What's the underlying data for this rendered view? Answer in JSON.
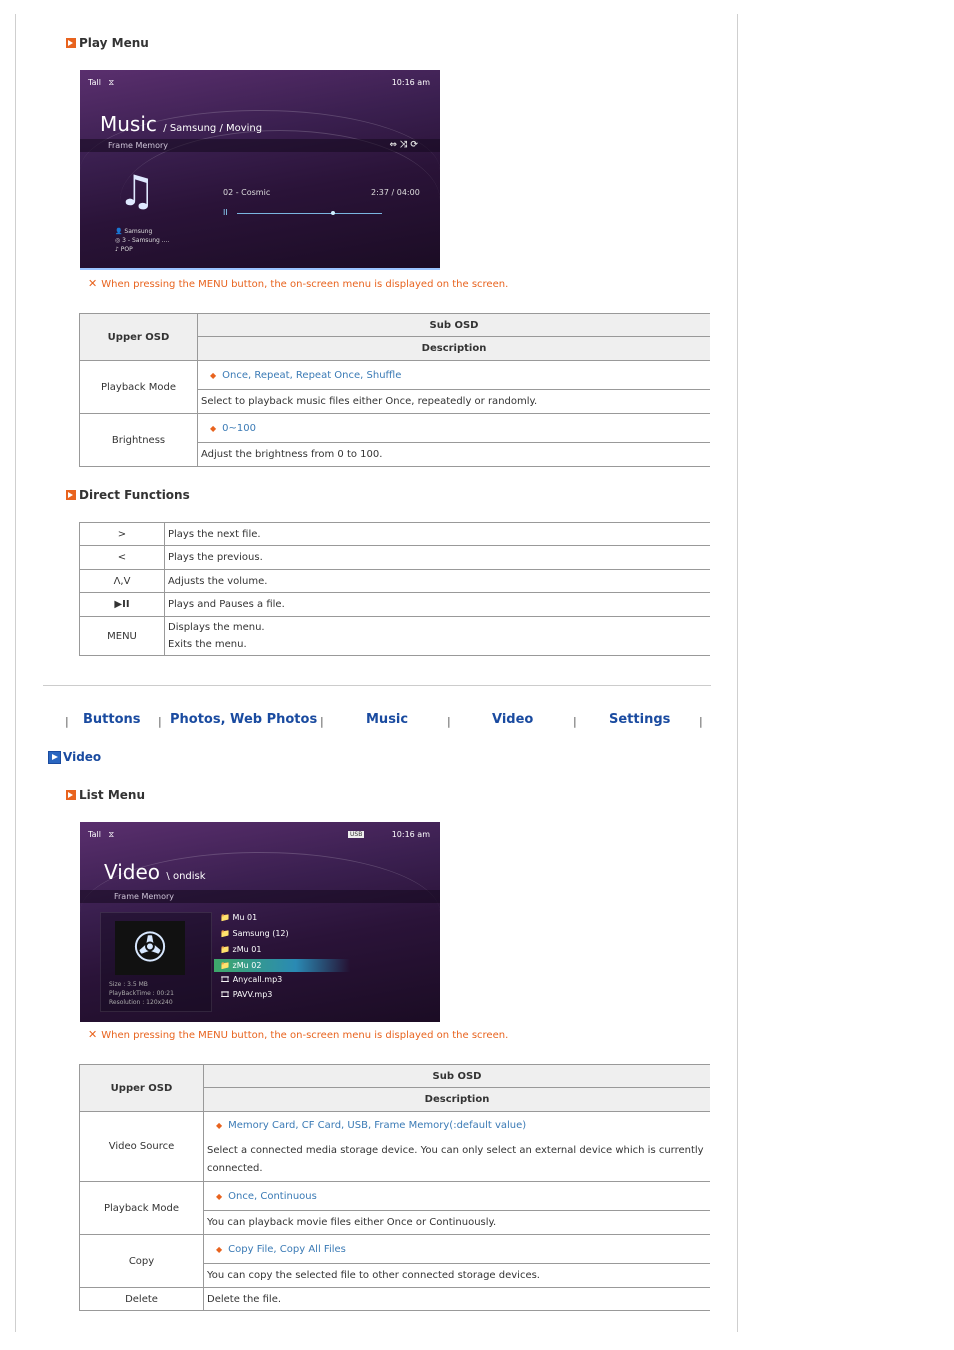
{
  "play_menu": {
    "heading": "Play Menu",
    "screen": {
      "time": "10:16 am",
      "title": "Music",
      "subtitle": "/ Samsung / Moving",
      "source": "Frame Memory",
      "track": "02 - Cosmic",
      "progress_time": "2:37 / 04:00",
      "progress": 0.65,
      "info": [
        "Samsung",
        "3 - Samsung ....",
        "POP"
      ]
    },
    "note": "When pressing the MENU button, the on-screen menu is displayed on the screen.",
    "table": {
      "upper_osd": "Upper OSD",
      "sub_osd": "Sub OSD",
      "description": "Description",
      "rows": [
        {
          "name": "Playback Mode",
          "options": "Once, Repeat, Repeat Once, Shuffle",
          "desc": "Select to playback music files either Once, repeatedly or randomly."
        },
        {
          "name": "Brightness",
          "options": "0~100",
          "desc": "Adjust the brightness from 0 to 100."
        }
      ]
    }
  },
  "direct_functions": {
    "heading": "Direct Functions",
    "rows": [
      {
        "key": ">",
        "desc": "Plays the next file."
      },
      {
        "key": "<",
        "desc": "Plays the previous."
      },
      {
        "key": "Λ,V",
        "desc": "Adjusts the volume."
      },
      {
        "key": "▶II",
        "desc": "Plays and Pauses a file."
      },
      {
        "key": "MENU",
        "desc": "Displays the menu.",
        "desc2": "Exits the menu."
      }
    ]
  },
  "nav": {
    "items": [
      "Buttons",
      "Photos, Web Photos",
      "Music",
      "Video",
      "Settings"
    ],
    "sep": "|"
  },
  "video": {
    "heading": "Video",
    "list_menu": "List Menu",
    "screen": {
      "time": "10:16 am",
      "title": "Video",
      "subtitle": "\\ ondisk",
      "source": "Frame Memory",
      "files": [
        "Mu 01",
        "Samsung (12)",
        "zMu 01",
        "zMu 02",
        "Anycall.mp3",
        "PAVV.mp3"
      ],
      "info": [
        "Size : 3.5 MB",
        "PlayBackTime : 00:21",
        "Resolution : 120x240"
      ]
    },
    "note": "When pressing the MENU button, the on-screen menu is displayed on the screen.",
    "table": {
      "upper_osd": "Upper OSD",
      "sub_osd": "Sub OSD",
      "description": "Description",
      "rows": [
        {
          "name": "Video Source",
          "options": "Memory Card, CF Card, USB, Frame Memory(:default value)",
          "desc": "Select a connected media storage device. You can only select an external device which is currently connected."
        },
        {
          "name": "Playback Mode",
          "options": "Once, Continuous",
          "desc": "You can playback movie files either Once or Continuously."
        },
        {
          "name": "Copy",
          "options": "Copy File, Copy All Files",
          "desc": "You can copy the selected file to other connected storage devices."
        },
        {
          "name": "Delete",
          "desc": "Delete the file."
        }
      ]
    }
  }
}
